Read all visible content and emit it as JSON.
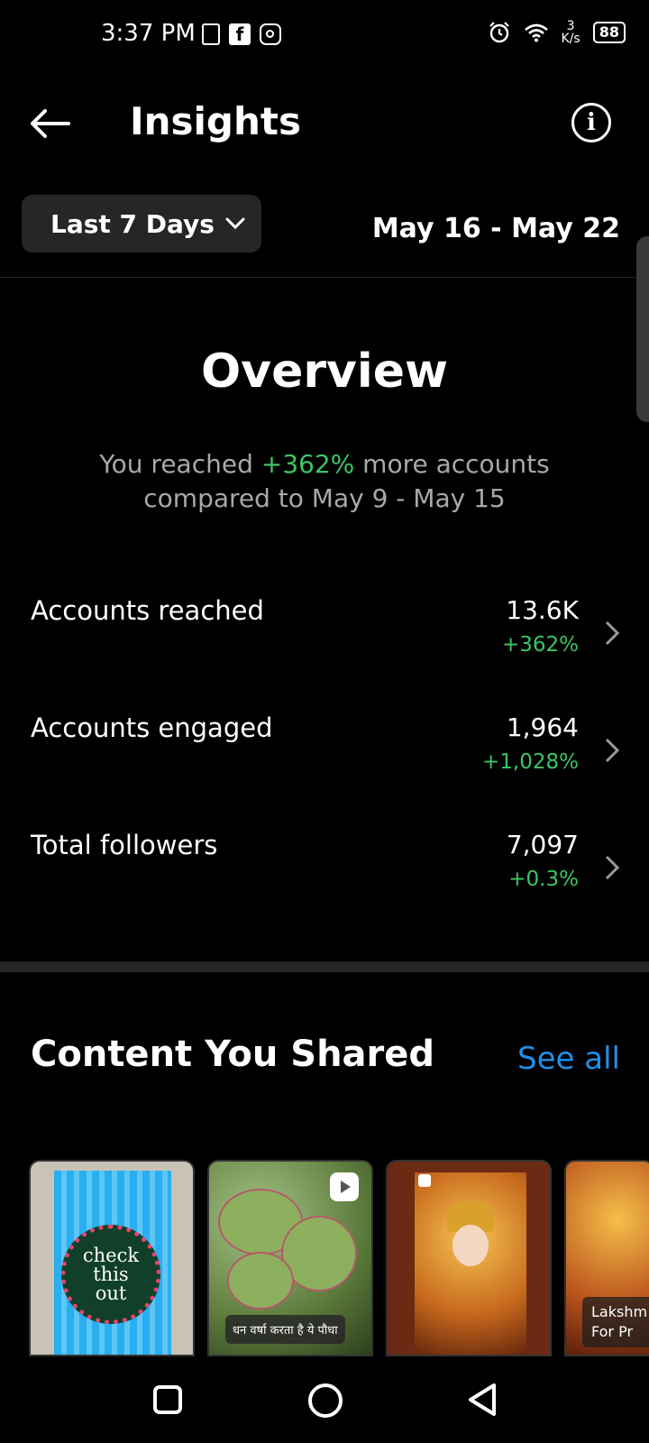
{
  "status_bar": {
    "time": "3:37 PM",
    "net_speed_value": "3",
    "net_speed_unit": "K/s",
    "battery": "88",
    "icons": [
      "battery-saver-icon",
      "facebook-icon",
      "instagram-icon",
      "alarm-icon",
      "wifi-icon",
      "battery-icon"
    ]
  },
  "header": {
    "title": "Insights",
    "back_icon": "arrow-left-icon",
    "info_icon": "info-icon",
    "info_glyph": "i"
  },
  "filter": {
    "range_label": "Last 7 Days",
    "chevron": "chevron-down-icon",
    "date_range": "May 16 - May 22"
  },
  "overview": {
    "title": "Overview",
    "desc_prefix": "You reached ",
    "desc_highlight": "+362%",
    "desc_suffix": " more accounts compared to May 9 - May 15",
    "metrics": [
      {
        "label": "Accounts reached",
        "value": "13.6K",
        "delta": "+362%"
      },
      {
        "label": "Accounts engaged",
        "value": "1,964",
        "delta": "+1,028%"
      },
      {
        "label": "Total followers",
        "value": "7,097",
        "delta": "+0.3%"
      }
    ]
  },
  "content": {
    "title": "Content You Shared",
    "see_all": "See all",
    "thumbs": [
      {
        "badge_line1": "check",
        "badge_line2": "this",
        "badge_line3": "out"
      },
      {
        "caption": "धन वर्षा करता है ये पौधा"
      },
      {},
      {
        "caption_line1": "Lakshm",
        "caption_line2": "For Pr"
      }
    ]
  },
  "colors": {
    "background": "#000000",
    "accent_green": "#3bc565",
    "link_blue": "#1f8fe8",
    "muted": "#a8a8a8",
    "button_bg": "#262626"
  }
}
